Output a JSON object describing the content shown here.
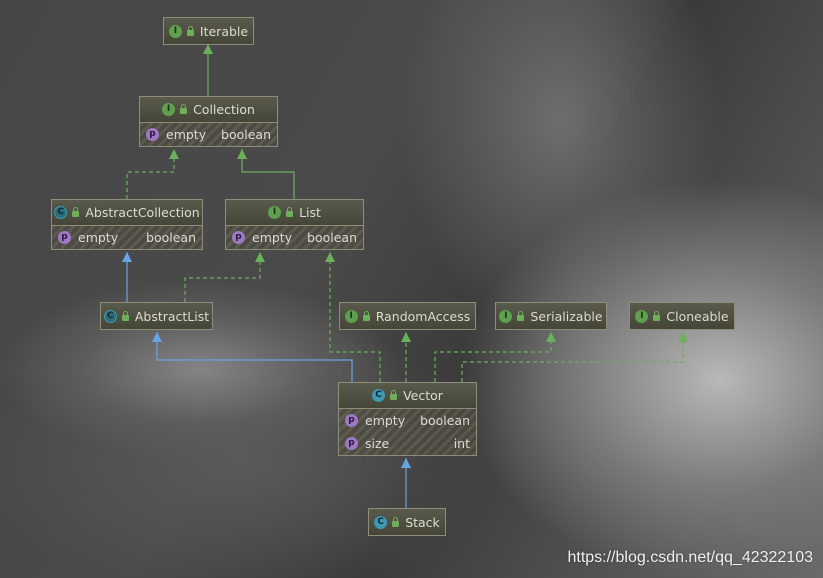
{
  "colors": {
    "extends_edge": "#6aa3e6",
    "implements_edge": "#6bb05a",
    "interface_badge": "#5fa04e",
    "class_badge": "#3d9ab0",
    "property_badge": "#9c79c2"
  },
  "nodes": [
    {
      "id": "iterable",
      "kind": "I",
      "name": "Iterable",
      "fields": []
    },
    {
      "id": "collection",
      "kind": "I",
      "name": "Collection",
      "fields": [
        {
          "name": "empty",
          "type": "boolean"
        }
      ]
    },
    {
      "id": "abstractcollection",
      "kind": "C",
      "abstract": true,
      "name": "AbstractCollection",
      "fields": [
        {
          "name": "empty",
          "type": "boolean"
        }
      ]
    },
    {
      "id": "list",
      "kind": "I",
      "name": "List",
      "fields": [
        {
          "name": "empty",
          "type": "boolean"
        }
      ]
    },
    {
      "id": "abstractlist",
      "kind": "C",
      "abstract": true,
      "name": "AbstractList",
      "fields": []
    },
    {
      "id": "randomaccess",
      "kind": "I",
      "name": "RandomAccess",
      "fields": []
    },
    {
      "id": "serializable",
      "kind": "I",
      "name": "Serializable",
      "fields": []
    },
    {
      "id": "cloneable",
      "kind": "I",
      "name": "Cloneable",
      "fields": []
    },
    {
      "id": "vector",
      "kind": "C",
      "name": "Vector",
      "fields": [
        {
          "name": "empty",
          "type": "boolean"
        },
        {
          "name": "size",
          "type": "int"
        }
      ]
    },
    {
      "id": "stack",
      "kind": "C",
      "name": "Stack",
      "fields": []
    }
  ],
  "edges": [
    {
      "from": "collection",
      "to": "iterable",
      "type": "extends-interface"
    },
    {
      "from": "abstractcollection",
      "to": "collection",
      "type": "implements"
    },
    {
      "from": "list",
      "to": "collection",
      "type": "extends-interface"
    },
    {
      "from": "abstractlist",
      "to": "abstractcollection",
      "type": "extends"
    },
    {
      "from": "abstractlist",
      "to": "list",
      "type": "implements"
    },
    {
      "from": "vector",
      "to": "abstractlist",
      "type": "extends"
    },
    {
      "from": "vector",
      "to": "list",
      "type": "implements"
    },
    {
      "from": "vector",
      "to": "randomaccess",
      "type": "implements"
    },
    {
      "from": "vector",
      "to": "serializable",
      "type": "implements"
    },
    {
      "from": "vector",
      "to": "cloneable",
      "type": "implements"
    },
    {
      "from": "stack",
      "to": "vector",
      "type": "extends"
    }
  ],
  "watermark": "https://blog.csdn.net/qq_42322103"
}
